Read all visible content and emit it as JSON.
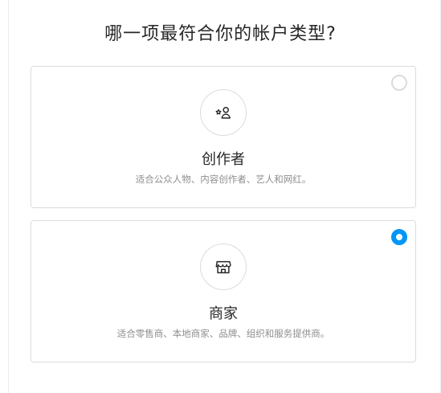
{
  "page": {
    "title": "哪一项最符合你的帐户类型?"
  },
  "options": [
    {
      "title": "创作者",
      "description": "适合公众人物、内容创作者、艺人和网红。",
      "icon": "creator-star-person-icon",
      "selected": false
    },
    {
      "title": "商家",
      "description": "适合零售商、本地商家、品牌、组织和服务提供商。",
      "icon": "storefront-icon",
      "selected": true
    }
  ],
  "colors": {
    "accent": "#0095f6",
    "border": "#dbdbdb",
    "text": "#262626",
    "muted": "#8e8e8e"
  }
}
